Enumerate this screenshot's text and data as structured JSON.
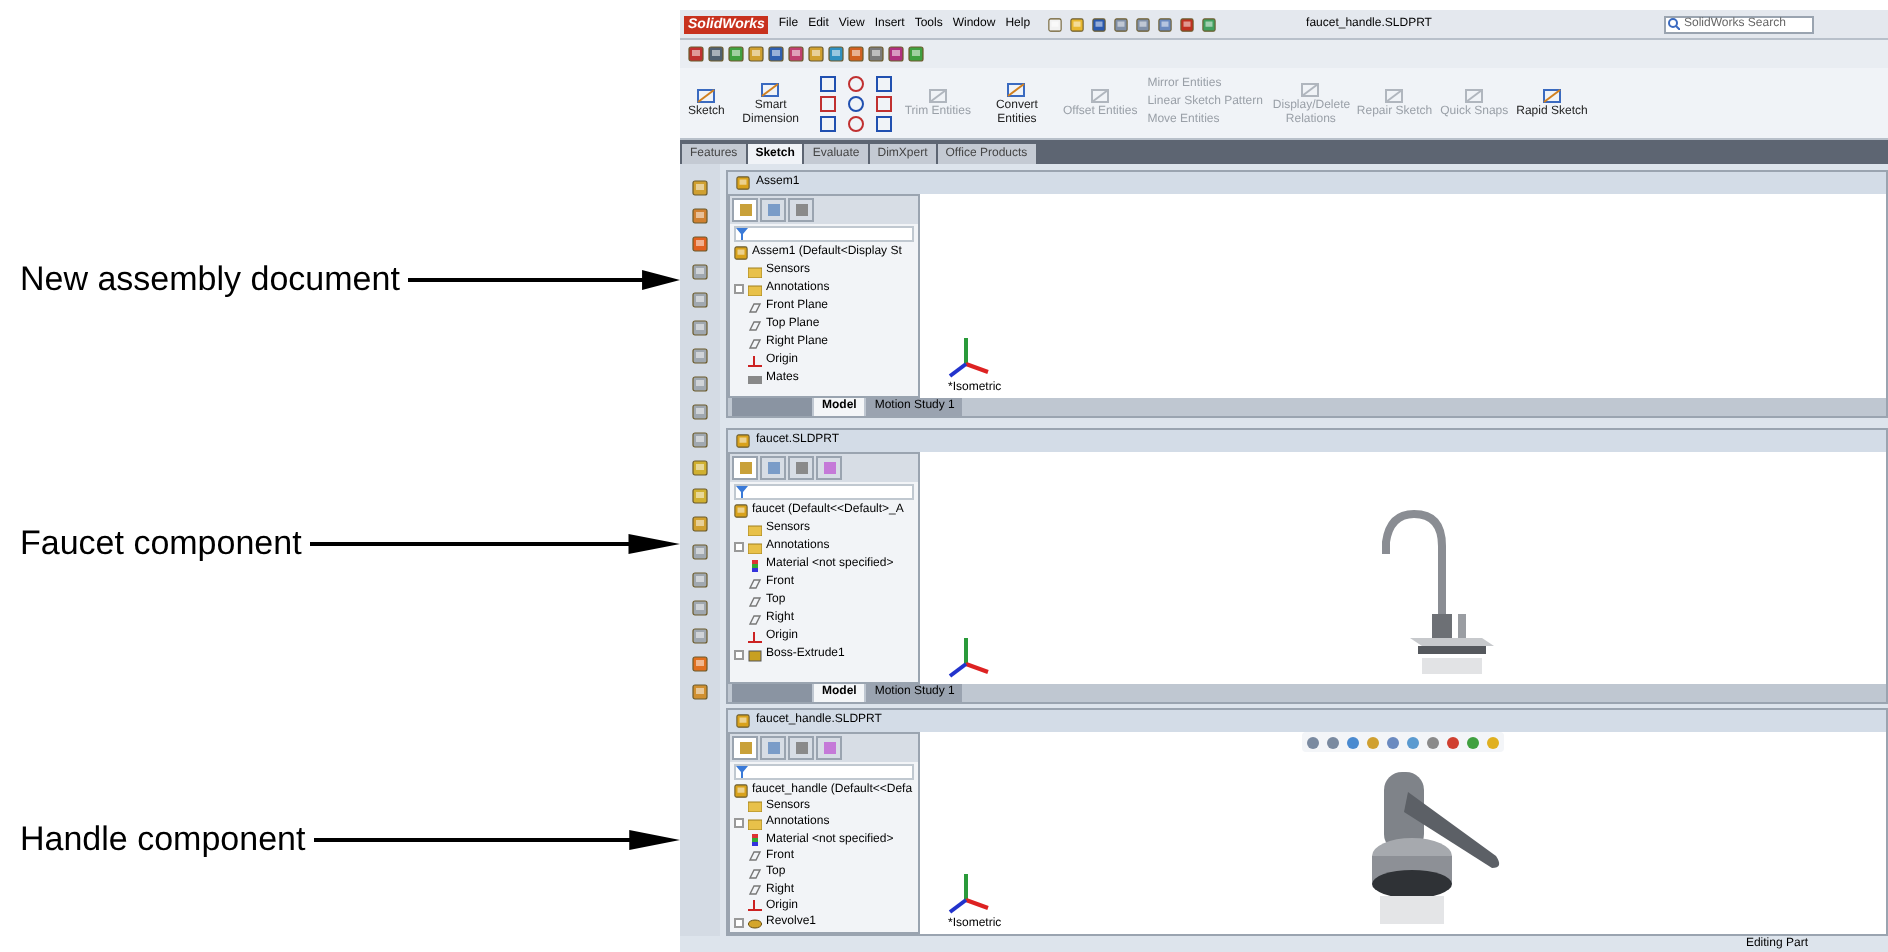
{
  "callouts": [
    {
      "label": "New assembly document"
    },
    {
      "label": "Faucet component"
    },
    {
      "label": "Handle component"
    }
  ],
  "app": {
    "logo": "SolidWorks",
    "menu": [
      "File",
      "Edit",
      "View",
      "Insert",
      "Tools",
      "Window",
      "Help"
    ],
    "title": "faucet_handle.SLDPRT",
    "search": {
      "placeholder": "SolidWorks Search"
    }
  },
  "command_manager": {
    "tools": [
      {
        "label": "Sketch",
        "kind": "large",
        "disabled": false
      },
      {
        "label": "Smart Dimension",
        "kind": "large",
        "disabled": false
      },
      {
        "kind": "palette"
      },
      {
        "label": "Trim Entities",
        "kind": "large",
        "disabled": true
      },
      {
        "label": "Convert Entities",
        "kind": "large",
        "disabled": false
      },
      {
        "label": "Offset Entities",
        "kind": "large",
        "disabled": true
      },
      {
        "kind": "stack",
        "items": [
          "Mirror Entities",
          "Linear Sketch Pattern",
          "Move Entities"
        ]
      },
      {
        "label": "Display/Delete Relations",
        "kind": "large",
        "disabled": true
      },
      {
        "label": "Repair Sketch",
        "kind": "large",
        "disabled": true
      },
      {
        "label": "Quick Snaps",
        "kind": "large",
        "disabled": true
      },
      {
        "label": "Rapid Sketch",
        "kind": "large",
        "disabled": false
      }
    ],
    "tabs": [
      {
        "label": "Features",
        "selected": false
      },
      {
        "label": "Sketch",
        "selected": true
      },
      {
        "label": "Evaluate",
        "selected": false
      },
      {
        "label": "DimXpert",
        "selected": false
      },
      {
        "label": "Office Products",
        "selected": false
      }
    ]
  },
  "documents": [
    {
      "title": "Assem1",
      "panel_tabs": [
        {
          "kind": "tree",
          "selected": true
        },
        {
          "kind": "properties",
          "selected": false
        },
        {
          "kind": "config",
          "selected": false
        }
      ],
      "root": "Assem1  (Default<Display St",
      "view_label": "*Isometric",
      "tree": [
        {
          "label": "Sensors",
          "kind": "folder",
          "expandable": false
        },
        {
          "label": "Annotations",
          "kind": "folder",
          "expandable": true
        },
        {
          "label": "Front Plane",
          "kind": "plane",
          "expandable": false
        },
        {
          "label": "Top Plane",
          "kind": "plane",
          "expandable": false
        },
        {
          "label": "Right Plane",
          "kind": "plane",
          "expandable": false
        },
        {
          "label": "Origin",
          "kind": "origin",
          "expandable": false
        },
        {
          "label": "Mates",
          "kind": "mates",
          "expandable": false
        }
      ],
      "bottom_tabs": [
        {
          "label": "Model",
          "selected": true
        },
        {
          "label": "Motion Study 1",
          "selected": false
        }
      ]
    },
    {
      "title": "faucet.SLDPRT",
      "panel_tabs": [
        {
          "kind": "tree",
          "selected": true
        },
        {
          "kind": "properties",
          "selected": false
        },
        {
          "kind": "config",
          "selected": false
        },
        {
          "kind": "display",
          "selected": false
        }
      ],
      "root": "faucet  (Default<<Default>_A",
      "picture": {
        "kind": "picture"
      },
      "tree": [
        {
          "label": "Sensors",
          "kind": "folder",
          "expandable": false
        },
        {
          "label": "Annotations",
          "kind": "folder",
          "expandable": true
        },
        {
          "label": "Material <not specified>",
          "kind": "material",
          "expandable": false
        },
        {
          "label": "Front",
          "kind": "plane",
          "expandable": false
        },
        {
          "label": "Top",
          "kind": "plane",
          "expandable": false
        },
        {
          "label": "Right",
          "kind": "plane",
          "expandable": false
        },
        {
          "label": "Origin",
          "kind": "origin",
          "expandable": false
        },
        {
          "label": "Boss-Extrude1",
          "kind": "feature",
          "expandable": true
        }
      ],
      "bottom_tabs": [
        {
          "label": "Model",
          "selected": true
        },
        {
          "label": "Motion Study 1",
          "selected": false
        }
      ]
    },
    {
      "title": "faucet_handle.SLDPRT",
      "panel_tabs": [
        {
          "kind": "tree",
          "selected": true
        },
        {
          "kind": "properties",
          "selected": false
        },
        {
          "kind": "config",
          "selected": false
        },
        {
          "kind": "display",
          "selected": false
        }
      ],
      "root": "faucet_handle  (Default<<Defa",
      "heads_up_toolbar": true,
      "view_label": "*Isometric",
      "picture": {
        "kind": "picture"
      },
      "tree": [
        {
          "label": "Sensors",
          "kind": "folder",
          "expandable": false
        },
        {
          "label": "Annotations",
          "kind": "folder",
          "expandable": true
        },
        {
          "label": "Material <not specified>",
          "kind": "material",
          "expandable": false
        },
        {
          "label": "Front",
          "kind": "plane",
          "expandable": false
        },
        {
          "label": "Top",
          "kind": "plane",
          "expandable": false
        },
        {
          "label": "Right",
          "kind": "plane",
          "expandable": false
        },
        {
          "label": "Origin",
          "kind": "origin",
          "expandable": false
        },
        {
          "label": "Revolve1",
          "kind": "revolve",
          "expandable": true
        }
      ]
    }
  ],
  "status_bar": {
    "text": "Editing Part"
  }
}
